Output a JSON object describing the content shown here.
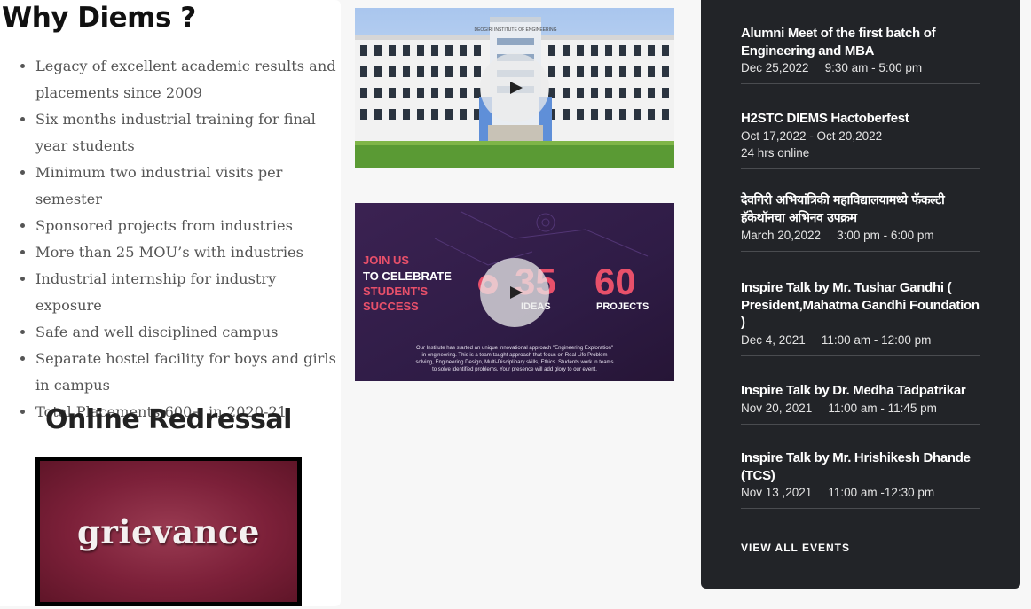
{
  "why": {
    "title": "Why Diems ?",
    "items": [
      "Legacy of excellent academic results and placements since 2009",
      "Six months industrial training for final year students",
      "Minimum two industrial visits per semester",
      "Sponsored projects from industries",
      "More than 25 MOU’s with industries",
      "Industrial internship for industry exposure",
      "Safe and well disciplined campus",
      "Separate hostel facility for boys and girls in campus",
      "Total Placements 600+  in 2020-21"
    ]
  },
  "redressal": {
    "title": "Online Redressal",
    "image_text": "grievance"
  },
  "videos": {
    "video1": {
      "sign_text": "DEOGIRI INSTITUTE OF ENGINEERING"
    },
    "video2": {
      "join_text": "JOIN US",
      "celebrate_text": "TO CELEBRATE",
      "students_text": "STUDENT'S",
      "success_text": "SUCCESS",
      "ideas_num": "35",
      "projects_num": "60",
      "ideas_label": "IDEAS",
      "projects_label": "PROJECTS",
      "desc_line1": "Our Institute has started an unique innovational approach \"Engineering Exploration\"",
      "desc_line2": "in engineering. This is  a team-taught approach that focus on Real Life Problem",
      "desc_line3": "solving, Engineering Design, Multi-Disciplinary skills, Ethics. Students work in teams",
      "desc_line4": "to solve identified problems. Your presence will add glory to our event."
    }
  },
  "events": [
    {
      "title": "Alumni Meet of the first batch of Engineering and MBA",
      "date": "Dec 25,2022",
      "time": "9:30 am - 5:00 pm"
    },
    {
      "title": "H2STC DIEMS Hactoberfest",
      "date": "Oct 17,2022 - Oct 20,2022",
      "time": "24 hrs online"
    },
    {
      "title": "देवगिरी अभियांत्रिकी महाविद्यालयामध्ये फॅकल्टी हॅकेथॉनचा अभिनव उपक्रम",
      "date": "March 20,2022",
      "time": "3:00 pm - 6:00 pm"
    },
    {
      "title": "Inspire Talk by Mr. Tushar Gandhi ( President,Mahatma Gandhi Foundation )",
      "date": "Dec 4, 2021",
      "time": "11:00 am - 12:00 pm"
    },
    {
      "title": "Inspire Talk by Dr. Medha Tadpatrikar",
      "date": "Nov 20, 2021",
      "time": "11:00 am - 11:45 pm"
    },
    {
      "title": "Inspire Talk by Mr. Hrishikesh Dhande (TCS)",
      "date": "Nov 13 ,2021",
      "time": "11:00 am -12:30 pm"
    }
  ],
  "view_all": "VIEW ALL EVENTS",
  "colors": {
    "panel_bg": "#222428",
    "grievance_bg": "#7c2039",
    "promo_pink": "#e8506a"
  },
  "icons": {
    "play": "play-icon"
  }
}
